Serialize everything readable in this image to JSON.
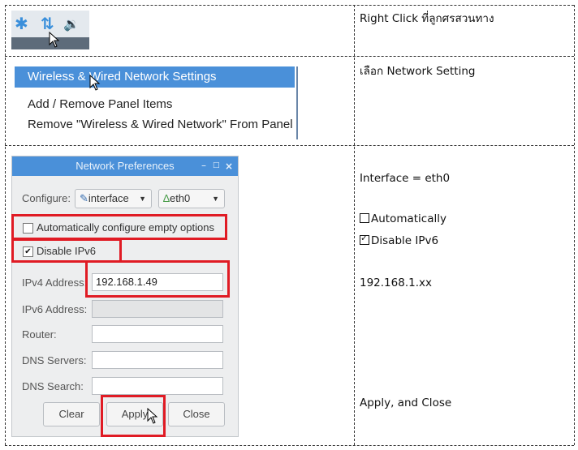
{
  "rows": [
    {
      "instruction": "Right Click ที่ลูกศรสวนทาง"
    },
    {
      "instruction": "เลือก Network Setting"
    },
    {
      "instruction_interface": "Interface = eth0",
      "instruction_auto": "Automatically",
      "instruction_ipv6": "Disable IPv6",
      "instruction_ip": "192.168.1.xx",
      "instruction_apply": "Apply, and Close"
    }
  ],
  "taskbar_icons": [
    "bluetooth-icon",
    "network-arrows-icon",
    "volume-icon"
  ],
  "context_menu": {
    "selected": "Wireless & Wired Network Settings",
    "items": [
      "Add / Remove Panel Items",
      "Remove \"Wireless & Wired Network\" From Panel"
    ]
  },
  "dialog": {
    "title": "Network Preferences",
    "configure_label": "Configure:",
    "configure_value": "interface",
    "interface_value": "eth0",
    "auto_label": "Automatically configure empty options",
    "auto_checked": false,
    "ipv6_label": "Disable IPv6",
    "ipv6_checked": true,
    "ipv4_label": "IPv4 Address:",
    "ipv4_value": "192.168.1.49",
    "ipv6_addr_label": "IPv6 Address:",
    "router_label": "Router:",
    "dns_servers_label": "DNS Servers:",
    "dns_search_label": "DNS Search:",
    "clear": "Clear",
    "apply": "Apply",
    "close": "Close"
  },
  "colors": {
    "highlight": "#4a90d9",
    "annotation": "#e01b24"
  }
}
